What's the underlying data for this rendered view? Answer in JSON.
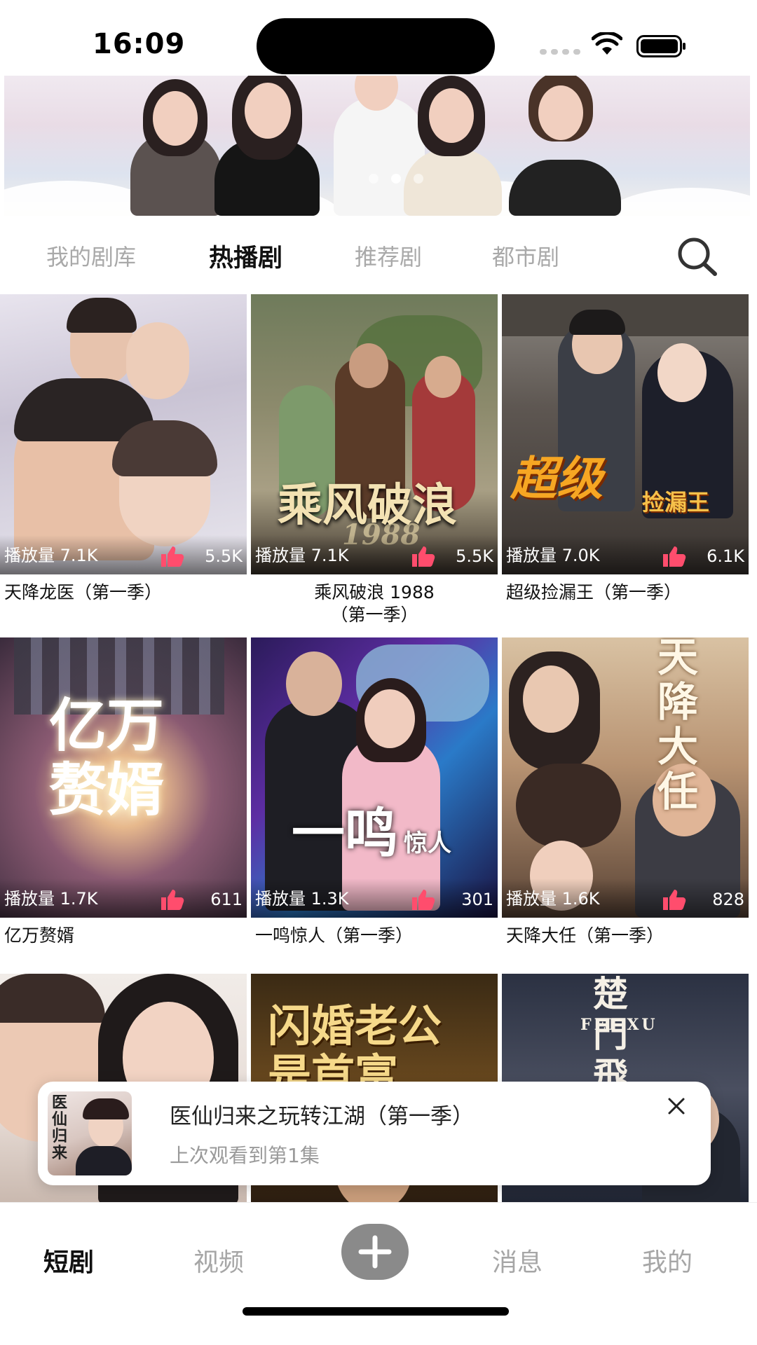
{
  "status_bar": {
    "time": "16:09"
  },
  "banner": {
    "slides": 3,
    "active_slide": 1
  },
  "category_tabs": {
    "items": [
      {
        "label": "我的剧库",
        "active": false
      },
      {
        "label": "热播剧",
        "active": true
      },
      {
        "label": "推荐剧",
        "active": false
      },
      {
        "label": "都市剧",
        "active": false
      }
    ]
  },
  "dramas": [
    {
      "views": "播放量 7.1K",
      "likes": "5.5K",
      "title": "天降龙医（第一季）"
    },
    {
      "views": "播放量 7.1K",
      "likes": "5.5K",
      "title": "乘风破浪 1988\n（第一季）",
      "poster_text": "乘风破浪",
      "poster_sub": "1988"
    },
    {
      "views": "播放量 7.0K",
      "likes": "6.1K",
      "title": "超级捡漏王（第一季）",
      "poster_text": "超级",
      "poster_sub": "捡漏王"
    },
    {
      "views": "播放量 1.7K",
      "likes": "611",
      "title": "亿万赘婿",
      "poster_text": "亿万赘婿"
    },
    {
      "views": "播放量 1.3K",
      "likes": "301",
      "title": "一鸣惊人（第一季）",
      "poster_text": "一鸣",
      "poster_sub": "惊人"
    },
    {
      "views": "播放量 1.6K",
      "likes": "828",
      "title": "天降大任（第一季）",
      "poster_text": "天降大任"
    },
    {
      "title": ""
    },
    {
      "title": "",
      "poster_text": "闪婚老公是首富"
    },
    {
      "title": "",
      "poster_text": "楚門飛婿",
      "poster_sub": "FEI XU"
    }
  ],
  "resume": {
    "title": "医仙归来之玩转江湖（第一季）",
    "subtitle": "上次观看到第1集",
    "thumb_text": "医仙归来"
  },
  "tab_bar": {
    "items": [
      {
        "label": "短剧",
        "active": true
      },
      {
        "label": "视频",
        "active": false
      },
      {
        "label": "消息",
        "active": false
      },
      {
        "label": "我的",
        "active": false
      }
    ]
  },
  "colors": {
    "accent_like": "#ff4d6d",
    "tab_active": "#111111",
    "tab_inactive": "#a6a6a6"
  }
}
